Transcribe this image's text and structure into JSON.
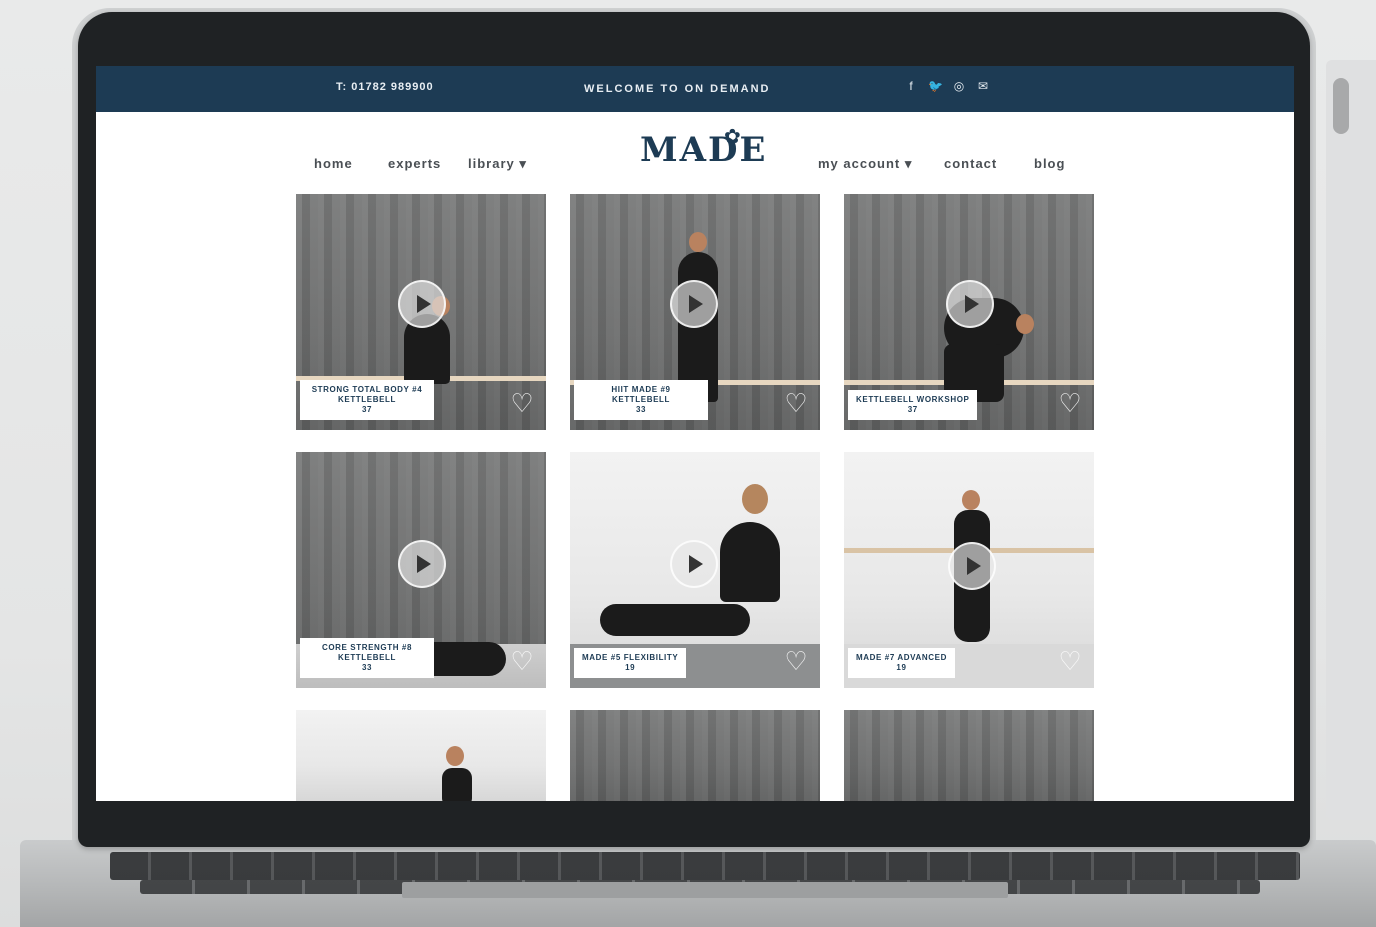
{
  "topbar": {
    "phone": "T: 01782 989900",
    "welcome": "WELCOME TO ON DEMAND",
    "social_icons": [
      "facebook-icon",
      "twitter-icon",
      "instagram-icon",
      "email-icon"
    ]
  },
  "nav": {
    "logo": "MADE",
    "left_items": [
      "home",
      "experts",
      "library ▾"
    ],
    "right_items": [
      "my account ▾",
      "contact",
      "blog"
    ]
  },
  "videos": [
    {
      "title": "STRONG TOTAL BODY #4 KETTLEBELL",
      "duration": "37"
    },
    {
      "title": "HIIT MADE #9 KETTLEBELL",
      "duration": "33"
    },
    {
      "title": "KETTLEBELL WORKSHOP",
      "duration": "37"
    },
    {
      "title": "CORE STRENGTH #8 KETTLEBELL",
      "duration": "33"
    },
    {
      "title": "MADE #5 FLEXIBILITY",
      "duration": "19"
    },
    {
      "title": "MADE #7 ADVANCED",
      "duration": "19"
    },
    {
      "title": "",
      "duration": ""
    },
    {
      "title": "",
      "duration": ""
    },
    {
      "title": "",
      "duration": ""
    }
  ],
  "colors": {
    "topbar_bg": "#1d3b54",
    "brand": "#1d3b54",
    "page_bg": "#ffffff"
  }
}
